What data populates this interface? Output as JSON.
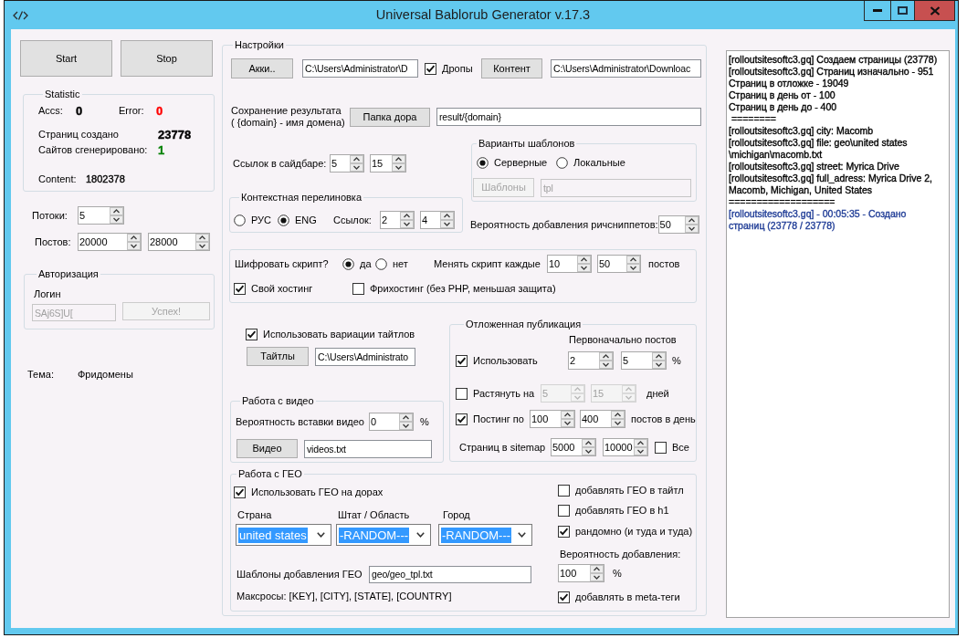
{
  "window": {
    "title": "Universal Bablorub Generator v.17.3"
  },
  "actions": [
    {
      "label": "Start"
    },
    {
      "label": "Stop"
    }
  ],
  "statistic": {
    "title": "Statistic",
    "rows": [
      {
        "items": [
          {
            "label": "Accs:",
            "value": "0",
            "kind": "count",
            "color": "#000000"
          },
          {
            "label": "Error:",
            "value": "0",
            "kind": "count",
            "color": "#ff0000"
          }
        ]
      },
      {
        "items": [
          {
            "label": "Страниц создано",
            "value": "23778",
            "kind": "count",
            "color": "#000000"
          }
        ]
      },
      {
        "items": [
          {
            "label": "Сайтов сгенерировано:",
            "value": "1",
            "kind": "count",
            "color": "#008000"
          }
        ]
      },
      {
        "items": [
          {
            "label": "Content:",
            "value": "1802378",
            "kind": "plain",
            "color": "#000000"
          }
        ]
      }
    ]
  },
  "threads": {
    "label": "Потоки:",
    "spinners": [
      {
        "value": "5"
      }
    ]
  },
  "posts": {
    "label": "Постов:",
    "spinners": [
      {
        "value": "20000"
      },
      {
        "value": "28000"
      }
    ]
  },
  "authorization": {
    "title": "Авторизация",
    "login_label": "Логин",
    "login": {
      "value": "SAj6S]U[",
      "disabled": true
    },
    "button": {
      "label": "Успех!",
      "disabled": true
    }
  },
  "theme": {
    "label": "Тема:",
    "value": "Фридомены"
  },
  "settings": {
    "title": "Настройки",
    "accounts": {
      "button": "Акки..",
      "path": "C:\\Users\\Administrator\\D"
    },
    "drops": {
      "label": "Дропы",
      "checked": true
    },
    "content": {
      "button": "Контент",
      "path": "C:\\Users\\Administrator\\Downloac"
    },
    "output": {
      "label": "Сохранение результата",
      "hint": "( {domain} - имя домена)",
      "button": "Папка дора",
      "path": "result/{domain}"
    },
    "sidebar_links": {
      "label": "Ссылок в сайдбаре:",
      "spinners": [
        {
          "value": "5"
        },
        {
          "value": "15"
        }
      ]
    },
    "context_links": {
      "title": "Контекстная перелиновка",
      "languages": [
        {
          "label": "РУС",
          "selected": false
        },
        {
          "label": "ENG",
          "selected": true
        }
      ],
      "count_label": "Ссылок:",
      "spinners": [
        {
          "value": "2"
        },
        {
          "value": "4"
        }
      ]
    },
    "templates": {
      "title": "Варианты шаблонов",
      "options": [
        {
          "label": "Серверные",
          "selected": true
        },
        {
          "label": "Локальные",
          "selected": false
        }
      ],
      "button": {
        "label": "Шаблоны",
        "disabled": true
      },
      "path": {
        "value": "tpl",
        "disabled": true
      }
    },
    "rich_snippets": {
      "label": "Вероятность добавления ричсниппетов:",
      "spinners": [
        {
          "value": "50"
        }
      ]
    },
    "script": {
      "encrypt_label": "Шифровать скрипт?",
      "encrypt_options": [
        {
          "label": "да",
          "selected": true
        },
        {
          "label": "нет",
          "selected": false
        }
      ],
      "change_label": "Менять скрипт каждые",
      "spinners": [
        {
          "value": "10"
        },
        {
          "value": "50"
        }
      ],
      "unit": "постов",
      "hosting": [
        {
          "label": "Свой хостинг",
          "checked": true
        },
        {
          "label": "Фрихостинг (без PHP, меньшая защита)",
          "checked": false
        }
      ]
    },
    "titles": {
      "use": {
        "label": "Использовать вариации тайтлов",
        "checked": true
      },
      "button": "Тайтлы",
      "path": "C:\\Users\\Administrato"
    },
    "video": {
      "title": "Работа с видео",
      "chance_label": "Вероятность вставки видео",
      "spinners": [
        {
          "value": "0"
        }
      ],
      "unit": "%",
      "button": "Видео",
      "path": "videos.txt"
    },
    "delayed": {
      "title": "Отложенная публикация",
      "initial_label": "Первоначально постов",
      "rows": [
        {
          "kind": "check",
          "label": "Использовать",
          "checked": true,
          "spinners": [
            {
              "value": "2",
              "disabled": false
            },
            {
              "value": "5",
              "disabled": false
            }
          ],
          "unit": "%"
        },
        {
          "kind": "check",
          "label": "Растянуть на",
          "checked": false,
          "spinners": [
            {
              "value": "5",
              "disabled": true
            },
            {
              "value": "15",
              "disabled": true
            }
          ],
          "unit": "дней"
        },
        {
          "kind": "check",
          "label": "Постинг по",
          "checked": true,
          "spinners": [
            {
              "value": "100",
              "disabled": false
            },
            {
              "value": "400",
              "disabled": false
            }
          ],
          "unit": "постов в день"
        },
        {
          "kind": "plain",
          "label": "Страниц в sitemap",
          "spinners": [
            {
              "value": "5000",
              "disabled": false
            },
            {
              "value": "10000",
              "disabled": false
            }
          ],
          "all": {
            "label": "Все",
            "checked": false
          }
        }
      ]
    },
    "geo": {
      "title": "Работа с ГЕО",
      "use": {
        "label": "Использовать ГЕО на дорах",
        "checked": true
      },
      "selects": [
        {
          "label": "Страна",
          "value": "united states",
          "highlighted": true
        },
        {
          "label": "Штат / Область",
          "value": "-RANDOM---",
          "highlighted": true
        },
        {
          "label": "Город",
          "value": "-RANDOM---",
          "highlighted": true
        }
      ],
      "templates_label": "Шаблоны добавления ГЕО",
      "templates_path": "geo/geo_tpl.txt",
      "macros": "Максросы: [KEY], [CITY], [STATE], [COUNTRY]",
      "options": [
        {
          "label": "добавлять ГЕО в тайтл",
          "checked": false
        },
        {
          "label": "добавлять ГЕО в h1",
          "checked": false
        },
        {
          "label": "рандомно (и туда и туда)",
          "checked": true
        }
      ],
      "chance_label": "Вероятность добавления:",
      "spinners": [
        {
          "value": "100"
        }
      ],
      "unit": "%",
      "meta": {
        "label": "добавлять в meta-теги",
        "checked": true
      }
    }
  },
  "log": {
    "lines": [
      {
        "text": "[rolloutsitesoftc3.gq] Создаем страницы (23778)",
        "color": "#000000"
      },
      {
        "text": "[rolloutsitesoftc3.gq] Страниц изначально - 951",
        "color": "#000000"
      },
      {
        "text": "Страниц в отложке - 19049",
        "color": "#000000"
      },
      {
        "text": "Страниц в день от - 100",
        "color": "#000000"
      },
      {
        "text": "Страниц в день до - 400",
        "color": "#000000"
      },
      {
        "text": " ========",
        "color": "#000000"
      },
      {
        "text": "[rolloutsitesoftc3.gq] city: Macomb",
        "color": "#000000"
      },
      {
        "text": "[rolloutsitesoftc3.gq] file: geo\\united states",
        "color": "#000000"
      },
      {
        "text": "\\michigan\\macomb.txt",
        "color": "#000000"
      },
      {
        "text": "[rolloutsitesoftc3.gq] street: Myrica Drive",
        "color": "#000000"
      },
      {
        "text": "[rolloutsitesoftc3.gq] full_adress: Myrica Drive 2,",
        "color": "#000000"
      },
      {
        "text": "Macomb, Michigan, United States",
        "color": "#000000"
      },
      {
        "text": "===================",
        "color": "#000000"
      },
      {
        "text": "[rolloutsitesoftc3.gq] - 00:05:35 - Создано",
        "color": "#1f3c96"
      },
      {
        "text": "страниц (23778 / 23778)",
        "color": "#1f3c96"
      }
    ]
  }
}
